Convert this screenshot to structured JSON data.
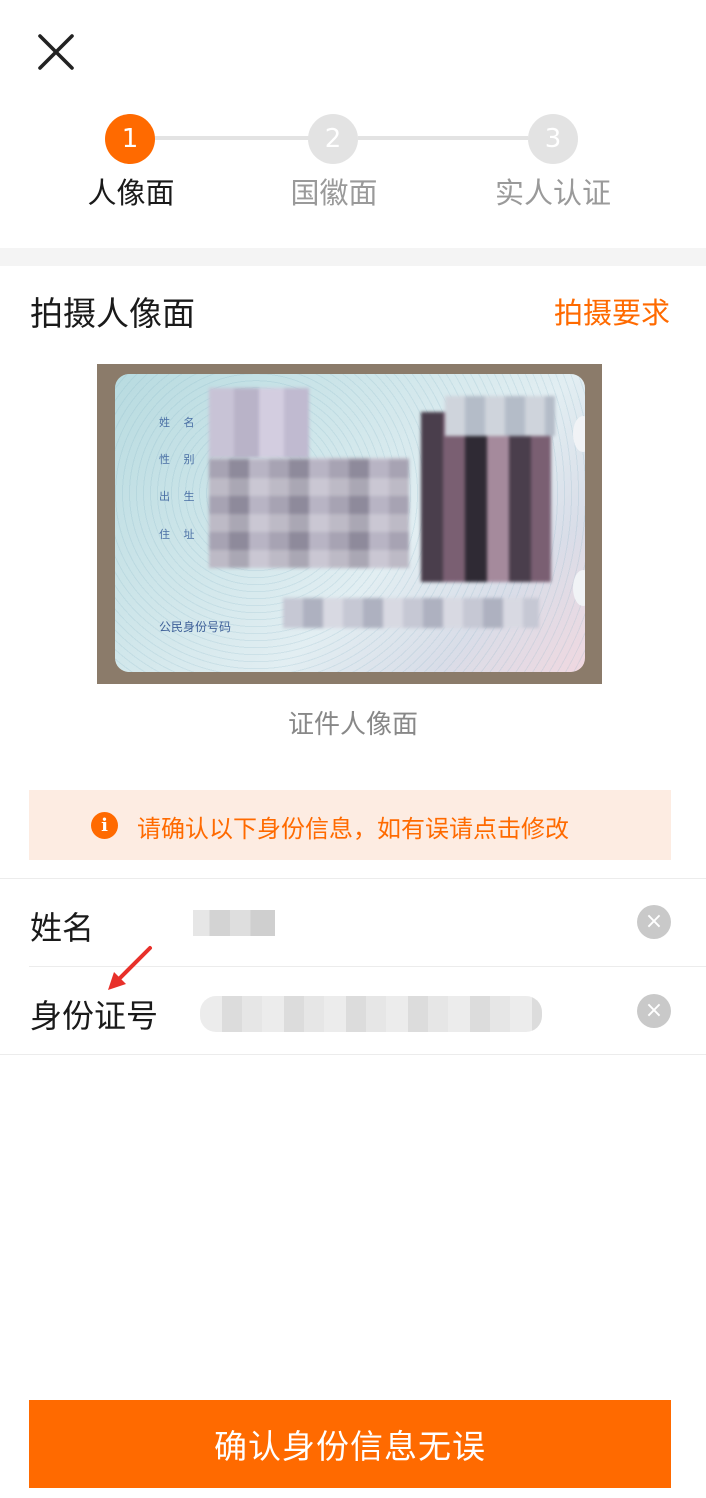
{
  "close_icon": "close-icon",
  "steps": [
    {
      "number": "1",
      "label": "人像面",
      "state": "active"
    },
    {
      "number": "2",
      "label": "国徽面",
      "state": "inactive"
    },
    {
      "number": "3",
      "label": "实人认证",
      "state": "inactive"
    }
  ],
  "capture": {
    "title": "拍摄人像面",
    "requirements_link": "拍摄要求",
    "caption": "证件人像面"
  },
  "id_card": {
    "field_labels": [
      "姓 名",
      "性 别",
      "出 生",
      "住 址"
    ],
    "id_number_label": "公民身份号码"
  },
  "notice": {
    "icon": "info-icon",
    "text": "请确认以下身份信息，如有误请点击修改"
  },
  "form": {
    "name_label": "姓名",
    "id_label": "身份证号"
  },
  "confirm_button": "确认身份信息无误",
  "colors": {
    "accent": "#ff6a00",
    "notice_bg": "#fdece2",
    "inactive_step": "#e3e3e3"
  }
}
